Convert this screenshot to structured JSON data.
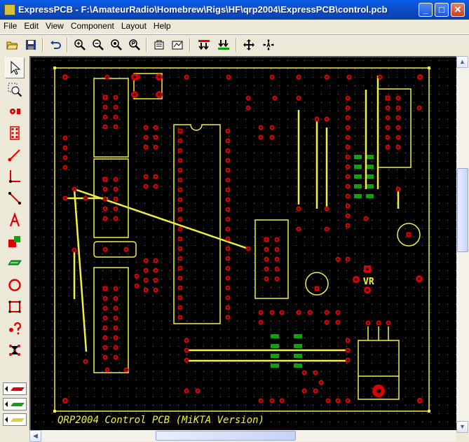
{
  "window": {
    "title": "ExpressPCB - F:\\AmateurRadio\\Homebrew\\Rigs\\HF\\qrp2004\\ExpressPCB\\control.pcb",
    "controls": {
      "minimize": "_",
      "maximize": "□",
      "close": "✕"
    }
  },
  "menu": {
    "items": [
      {
        "label": "File"
      },
      {
        "label": "Edit"
      },
      {
        "label": "View"
      },
      {
        "label": "Component"
      },
      {
        "label": "Layout"
      },
      {
        "label": "Help"
      }
    ]
  },
  "toolbar": {
    "buttons": [
      {
        "name": "open-icon"
      },
      {
        "name": "save-icon"
      },
      {
        "name": "undo-icon"
      },
      {
        "name": "zoom-in-icon"
      },
      {
        "name": "zoom-out-icon"
      },
      {
        "name": "zoom-fit-icon"
      },
      {
        "name": "zoom-previous-icon"
      },
      {
        "name": "component-properties-icon"
      },
      {
        "name": "part-library-icon"
      },
      {
        "name": "top-layer-icon"
      },
      {
        "name": "bottom-layer-icon"
      },
      {
        "name": "move-icon"
      },
      {
        "name": "move-text-icon"
      }
    ]
  },
  "left_tools": {
    "tools": [
      {
        "name": "select-tool-icon",
        "active": true
      },
      {
        "name": "zoom-tool-icon"
      },
      {
        "name": "place-pad-icon"
      },
      {
        "name": "place-component-icon"
      },
      {
        "name": "place-trace-icon"
      },
      {
        "name": "insert-corner-icon"
      },
      {
        "name": "trace-segment-icon"
      },
      {
        "name": "place-text-icon"
      },
      {
        "name": "filled-shape-icon"
      },
      {
        "name": "layer-swap-icon"
      },
      {
        "name": "circle-tool-icon"
      },
      {
        "name": "rectangle-tool-icon"
      },
      {
        "name": "query-tool-icon"
      },
      {
        "name": "netlist-tool-icon"
      }
    ],
    "layer_buttons": [
      {
        "name": "layer-top-icon"
      },
      {
        "name": "layer-bottom-icon"
      },
      {
        "name": "layer-silk-icon"
      }
    ]
  },
  "board": {
    "silkscreen_text": "QRP2004 Control PCB (MiKTA Version)",
    "component_label": "VR",
    "colors": {
      "background": "#000000",
      "pad": "#E00000",
      "silk": "#F0F040",
      "bottom_trace": "#10A010",
      "grid": "#808080"
    }
  }
}
